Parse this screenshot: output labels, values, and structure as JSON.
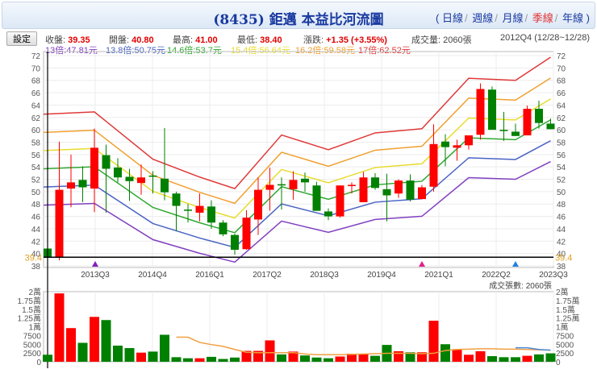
{
  "header": {
    "title": "(8435) 鉅邁 本益比河流圖",
    "periods": [
      "日線",
      "週線",
      "月線",
      "季線",
      "年線"
    ],
    "active_period": "季線",
    "open_paren": "(",
    "close_paren": ")"
  },
  "toolbar": {
    "settings_label": "設定"
  },
  "quote": {
    "close_label": "收盤:",
    "close": "39.35",
    "open_label": "開盤:",
    "open": "40.80",
    "high_label": "最高:",
    "high": "41.00",
    "low_label": "最低:",
    "low": "38.40",
    "change_label": "漲跌:",
    "change": "+1.35",
    "change_pct": "(+3.55%)",
    "volume_label": "成交量:",
    "volume": "2060張",
    "period": "2012Q4 (12/28~12/28)"
  },
  "bands": [
    {
      "label": "13倍:47.81元",
      "multiple": 13,
      "color": "#8040c0"
    },
    {
      "label": "13.8倍:50.75元",
      "multiple": 13.8,
      "color": "#4a64c4"
    },
    {
      "label": "14.6倍:53.7元",
      "multiple": 14.6,
      "color": "#30a830"
    },
    {
      "label": "15.4倍:56.64元",
      "multiple": 15.4,
      "color": "#e8dc30"
    },
    {
      "label": "16.2倍:59.58元",
      "multiple": 16.2,
      "color": "#f0a030"
    },
    {
      "label": "17倍:62.52元",
      "multiple": 17,
      "color": "#e03838"
    }
  ],
  "chart_data": {
    "type": "candlestick",
    "title": "(8435) 鉅邁 本益比河流圖",
    "price_axis": {
      "ylim": [
        38,
        72
      ],
      "ticks": [
        "38",
        "40",
        "42",
        "44",
        "46",
        "48",
        "50",
        "52",
        "54",
        "56",
        "58",
        "60",
        "62",
        "64",
        "66",
        "68",
        "70",
        "72"
      ]
    },
    "x_tick_labels": [
      "2013Q3",
      "2014Q4",
      "2016Q1",
      "2017Q2",
      "2018Q3",
      "2019Q4",
      "2021Q1",
      "2022Q2",
      "2023Q3"
    ],
    "cursor_price": "39.4",
    "colors": {
      "up": "#ff0000",
      "down": "#008000"
    },
    "candles": [
      [
        40.8,
        41.0,
        38.4,
        39.35
      ],
      [
        39.5,
        58.1,
        38.9,
        50.3
      ],
      [
        50.5,
        56.0,
        47.5,
        51.5
      ],
      [
        51.9,
        54.1,
        48.3,
        50.7
      ],
      [
        50.5,
        60.2,
        46.7,
        57.1
      ],
      [
        55.9,
        57.6,
        46.6,
        53.7
      ],
      [
        53.9,
        55.4,
        51.5,
        52.3
      ],
      [
        52.4,
        53.7,
        48.5,
        51.7
      ],
      [
        51.4,
        54.4,
        49.5,
        52.3
      ],
      [
        52.6,
        53.3,
        49.7,
        52.5
      ],
      [
        52.1,
        60.3,
        48.6,
        49.9
      ],
      [
        49.7,
        50.0,
        43.6,
        47.7
      ],
      [
        47.1,
        48.0,
        45.0,
        47.0
      ],
      [
        46.6,
        49.7,
        45.2,
        47.7
      ],
      [
        47.6,
        48.6,
        44.0,
        45.0
      ],
      [
        45.0,
        45.4,
        42.8,
        43.1
      ],
      [
        43.0,
        43.2,
        39.8,
        40.6
      ],
      [
        40.7,
        47.0,
        40.6,
        45.8
      ],
      [
        45.5,
        52.3,
        43.0,
        50.3
      ],
      [
        50.3,
        53.9,
        46.9,
        51.1
      ],
      [
        51.2,
        52.3,
        47.1,
        51.1
      ],
      [
        50.4,
        53.3,
        48.7,
        51.9
      ],
      [
        52.1,
        53.1,
        50.0,
        51.5
      ],
      [
        51.0,
        51.6,
        46.9,
        46.9
      ],
      [
        46.8,
        47.3,
        45.4,
        46.0
      ],
      [
        46.0,
        51.0,
        45.8,
        51.0
      ],
      [
        51.0,
        51.5,
        49.7,
        51.1
      ],
      [
        48.3,
        53.2,
        48.3,
        52.3
      ],
      [
        52.3,
        53.0,
        50.3,
        50.6
      ],
      [
        50.4,
        52.9,
        45.2,
        49.4
      ],
      [
        49.7,
        52.0,
        49.0,
        51.8
      ],
      [
        51.8,
        52.8,
        48.4,
        48.7
      ],
      [
        48.8,
        51.1,
        48.8,
        50.7
      ],
      [
        50.8,
        60.9,
        50.0,
        57.7
      ],
      [
        58.1,
        59.3,
        54.1,
        57.2
      ],
      [
        57.1,
        58.4,
        55.0,
        57.5
      ],
      [
        57.5,
        59.1,
        56.8,
        59.1
      ],
      [
        59.2,
        67.5,
        58.4,
        66.6
      ],
      [
        66.5,
        67.0,
        60.0,
        60.0
      ],
      [
        60.0,
        62.9,
        58.2,
        59.8
      ],
      [
        59.7,
        61.0,
        59.0,
        59.0
      ],
      [
        59.1,
        63.9,
        59.1,
        63.4
      ],
      [
        63.4,
        64.7,
        60.2,
        61.1
      ],
      [
        61.0,
        61.8,
        60.1,
        60.1
      ]
    ],
    "eps_knots": [
      [
        0,
        3.678
      ],
      [
        4,
        3.7
      ],
      [
        9,
        3.25
      ],
      [
        13,
        3.08
      ],
      [
        16,
        2.97
      ],
      [
        20,
        3.48
      ],
      [
        24,
        3.34
      ],
      [
        28,
        3.5
      ],
      [
        32,
        3.54
      ],
      [
        36,
        4.02
      ],
      [
        40,
        4.0
      ],
      [
        43,
        4.22
      ]
    ],
    "markers": [
      {
        "index": 4,
        "color": "#8020c0"
      },
      {
        "index": 32,
        "color": "#e0208a"
      },
      {
        "index": 40,
        "color": "#2080e0"
      }
    ],
    "volume_axis": {
      "ylim": [
        0,
        20000
      ],
      "ticks": [
        "0",
        "2500",
        "5000",
        "7500",
        "1萬",
        "1.25萬",
        "1.5萬",
        "1.75萬",
        "2萬"
      ]
    },
    "volume_label": "成交張數: 2060張",
    "volumes": [
      2000,
      19500,
      9600,
      5400,
      12800,
      11900,
      4600,
      3900,
      2600,
      2900,
      7700,
      1300,
      1000,
      1000,
      1400,
      800,
      1200,
      3100,
      3100,
      6100,
      2100,
      2900,
      1800,
      1200,
      1000,
      1500,
      2300,
      2300,
      1700,
      4800,
      3000,
      2700,
      2700,
      11700,
      5000,
      3600,
      2000,
      3000,
      1600,
      1300,
      1300,
      1700,
      2100,
      2400
    ],
    "volume_ma_orange": [
      null,
      null,
      null,
      null,
      null,
      null,
      null,
      null,
      null,
      null,
      null,
      7000,
      7000,
      5500,
      4900,
      4400,
      3500,
      2700,
      2600,
      2600,
      2600,
      2600,
      2200,
      2000,
      2000,
      2000,
      2100,
      2200,
      2300,
      2400,
      2400,
      2400,
      2300,
      2400,
      3200,
      3500,
      3600,
      3700,
      3700,
      3600,
      3600,
      3500,
      3400,
      3300
    ],
    "volume_ma_blue": [
      null,
      null,
      null,
      null,
      null,
      null,
      null,
      null,
      null,
      null,
      null,
      null,
      null,
      null,
      null,
      null,
      null,
      null,
      null,
      null,
      null,
      null,
      null,
      null,
      null,
      null,
      null,
      null,
      null,
      null,
      null,
      null,
      null,
      null,
      null,
      null,
      null,
      null,
      null,
      null,
      4000,
      4000,
      3500,
      3300
    ]
  }
}
